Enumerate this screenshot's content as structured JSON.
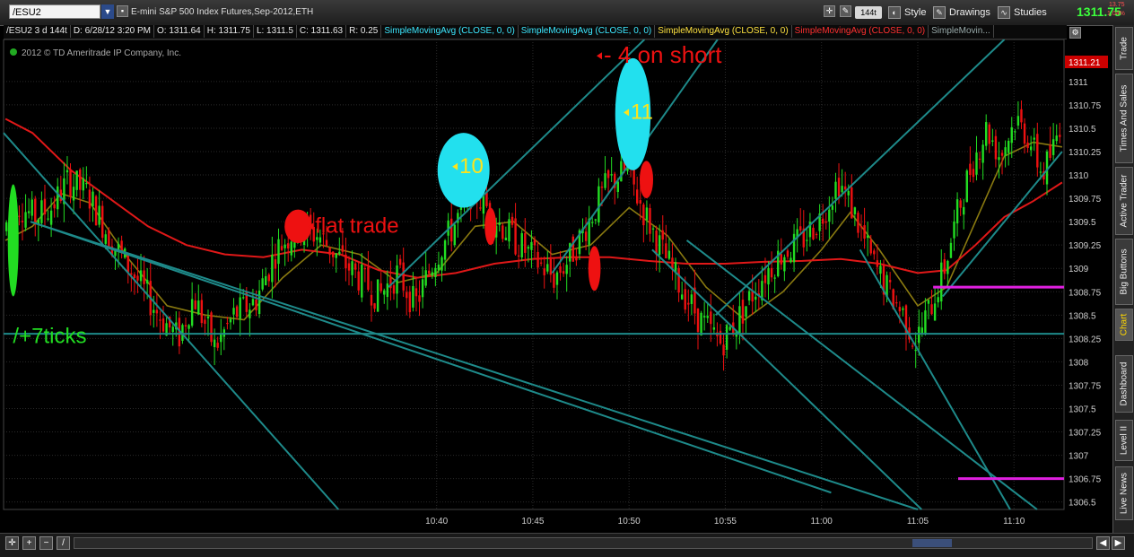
{
  "toolbar": {
    "symbol": "/ESU2",
    "title": "E-mini S&P 500 Index Futures,Sep-2012,ETH",
    "aggregation": "144t",
    "style_label": "Style",
    "drawings_label": "Drawings",
    "studies_label": "Studies",
    "last_price": "1311.75",
    "change": "13.75",
    "change_pct": "1.04%"
  },
  "infobar": {
    "symbol_period": "/ESU2 3 d 144t",
    "date": "D: 6/28/12 3:20 PM",
    "open": "O: 1311.64",
    "high": "H: 1311.75",
    "low": "L: 1311.5",
    "close": "C: 1311.63",
    "range": "R: 0.25",
    "studies": [
      {
        "label": "SimpleMovingAvg (CLOSE, 0, 0)",
        "color": "cyan"
      },
      {
        "label": "SimpleMovingAvg (CLOSE, 0, 0)",
        "color": "cyan"
      },
      {
        "label": "SimpleMovingAvg (CLOSE, 0, 0)",
        "color": "yellow"
      },
      {
        "label": "SimpleMovingAvg (CLOSE, 0, 0)",
        "color": "red"
      },
      {
        "label": "SimpleMovin...",
        "color": "gray"
      }
    ]
  },
  "copyright": "2012 © TD Ameritrade IP Company, Inc.",
  "sidebar_tabs": [
    "Trade",
    "Times And Sales",
    "Active Trader",
    "Big Buttons",
    "Chart",
    "Dashboard",
    "Level II",
    "Live News"
  ],
  "annotations": {
    "ticks": "/+7ticks",
    "flat": "flat trade",
    "short": "- 4 on short",
    "ten": "10",
    "eleven": "11"
  },
  "colors": {
    "up": "#22dd22",
    "down": "#ee1111",
    "ma_fast": "#8a7a10",
    "ma_slow": "#e01818",
    "trendline": "#1e8a8a",
    "level": "#e020e0",
    "cyan_marker": "#22e0ee",
    "red_marker": "#ee1111",
    "green_marker": "#22dd22"
  },
  "chart_data": {
    "type": "candlestick",
    "symbol": "/ESU2",
    "aggregation": "144 ticks",
    "x_ticks": [
      "10:40",
      "10:45",
      "10:50",
      "10:55",
      "11:00",
      "11:05",
      "11:10"
    ],
    "x_range_minutes": [
      617.5,
      672.6
    ],
    "y_ticks": [
      1306.5,
      1306.75,
      1307,
      1307.25,
      1307.5,
      1307.75,
      1308,
      1308.25,
      1308.5,
      1308.75,
      1309,
      1309.25,
      1309.5,
      1309.75,
      1310,
      1310.25,
      1310.5,
      1310.75,
      1311
    ],
    "ylim": [
      1306.42,
      1311.45
    ],
    "last_price_marker": "1311.21",
    "path": [
      [
        617.6,
        1309.4
      ],
      [
        618.3,
        1309.7
      ],
      [
        619.2,
        1309.55
      ],
      [
        620.1,
        1309.65
      ],
      [
        621.0,
        1309.95
      ],
      [
        622.0,
        1309.8
      ],
      [
        623.2,
        1309.3
      ],
      [
        624.5,
        1308.9
      ],
      [
        625.7,
        1308.5
      ],
      [
        626.7,
        1308.25
      ],
      [
        627.5,
        1308.7
      ],
      [
        628.6,
        1308.15
      ],
      [
        629.6,
        1308.5
      ],
      [
        630.7,
        1308.65
      ],
      [
        631.8,
        1309.2
      ],
      [
        632.9,
        1309.45
      ],
      [
        634.0,
        1309.35
      ],
      [
        635.1,
        1309.1
      ],
      [
        636.1,
        1308.9
      ],
      [
        637.1,
        1308.7
      ],
      [
        638.1,
        1308.95
      ],
      [
        639.0,
        1308.6
      ],
      [
        640.0,
        1309.1
      ],
      [
        641.0,
        1309.45
      ],
      [
        642.0,
        1309.85
      ],
      [
        643.1,
        1309.55
      ],
      [
        644.2,
        1309.3
      ],
      [
        645.2,
        1309.1
      ],
      [
        646.2,
        1308.9
      ],
      [
        647.0,
        1309.1
      ],
      [
        648.0,
        1309.5
      ],
      [
        649.0,
        1309.9
      ],
      [
        650.0,
        1310.05
      ],
      [
        650.9,
        1309.6
      ],
      [
        651.8,
        1309.2
      ],
      [
        652.8,
        1308.8
      ],
      [
        653.8,
        1308.45
      ],
      [
        654.9,
        1308.2
      ],
      [
        655.9,
        1308.5
      ],
      [
        657.0,
        1308.9
      ],
      [
        658.0,
        1309.15
      ],
      [
        659.1,
        1309.3
      ],
      [
        660.1,
        1309.55
      ],
      [
        661.0,
        1309.95
      ],
      [
        661.8,
        1309.6
      ],
      [
        662.7,
        1309.1
      ],
      [
        663.6,
        1308.75
      ],
      [
        664.4,
        1308.5
      ],
      [
        665.0,
        1308.2
      ],
      [
        665.8,
        1308.6
      ],
      [
        666.5,
        1309.0
      ],
      [
        667.2,
        1309.6
      ],
      [
        667.9,
        1310.1
      ],
      [
        668.7,
        1310.5
      ],
      [
        669.4,
        1310.2
      ],
      [
        670.2,
        1310.6
      ],
      [
        670.9,
        1310.4
      ],
      [
        671.6,
        1310.0
      ],
      [
        672.2,
        1310.3
      ],
      [
        672.5,
        1310.55
      ]
    ],
    "moving_averages": [
      {
        "color": "ma_fast",
        "points": [
          [
            617.6,
            1309.3
          ],
          [
            619.0,
            1309.45
          ],
          [
            620.5,
            1309.8
          ],
          [
            622.0,
            1309.7
          ],
          [
            624.0,
            1309.1
          ],
          [
            626.0,
            1308.6
          ],
          [
            628.0,
            1308.5
          ],
          [
            630.0,
            1308.45
          ],
          [
            632.0,
            1308.9
          ],
          [
            634.0,
            1309.25
          ],
          [
            636.0,
            1309.15
          ],
          [
            638.0,
            1308.85
          ],
          [
            640.0,
            1308.95
          ],
          [
            642.0,
            1309.45
          ],
          [
            644.0,
            1309.5
          ],
          [
            646.0,
            1309.15
          ],
          [
            648.0,
            1309.25
          ],
          [
            650.0,
            1309.65
          ],
          [
            652.0,
            1309.35
          ],
          [
            654.0,
            1308.8
          ],
          [
            656.0,
            1308.45
          ],
          [
            658.0,
            1308.75
          ],
          [
            660.0,
            1309.2
          ],
          [
            661.5,
            1309.6
          ],
          [
            663.0,
            1309.2
          ],
          [
            665.0,
            1308.6
          ],
          [
            666.5,
            1308.8
          ],
          [
            668.0,
            1309.5
          ],
          [
            669.5,
            1310.2
          ],
          [
            671.0,
            1310.35
          ],
          [
            672.5,
            1310.3
          ]
        ]
      },
      {
        "color": "ma_slow",
        "points": [
          [
            617.6,
            1310.6
          ],
          [
            619.0,
            1310.45
          ],
          [
            621.0,
            1310.05
          ],
          [
            623.0,
            1309.75
          ],
          [
            625.0,
            1309.45
          ],
          [
            627.0,
            1309.25
          ],
          [
            629.0,
            1309.15
          ],
          [
            631.0,
            1309.12
          ],
          [
            633.0,
            1309.2
          ],
          [
            635.0,
            1309.15
          ],
          [
            637.0,
            1308.98
          ],
          [
            639.0,
            1308.9
          ],
          [
            641.0,
            1308.95
          ],
          [
            643.0,
            1309.05
          ],
          [
            645.0,
            1309.1
          ],
          [
            647.0,
            1309.12
          ],
          [
            649.0,
            1309.12
          ],
          [
            651.0,
            1309.08
          ],
          [
            653.0,
            1309.05
          ],
          [
            655.0,
            1309.05
          ],
          [
            657.0,
            1309.07
          ],
          [
            659.0,
            1309.08
          ],
          [
            661.0,
            1309.1
          ],
          [
            663.0,
            1309.05
          ],
          [
            665.0,
            1308.95
          ],
          [
            666.5,
            1308.98
          ],
          [
            668.0,
            1309.25
          ],
          [
            669.5,
            1309.55
          ],
          [
            671.0,
            1309.72
          ],
          [
            672.5,
            1309.92
          ]
        ]
      }
    ],
    "trend_lines": [
      [
        617.5,
        1310.45,
        634.9,
        1306.42
      ],
      [
        618.9,
        1309.5,
        660.5,
        1306.6
      ],
      [
        618.9,
        1309.5,
        665.0,
        1306.42
      ],
      [
        637.5,
        1308.8,
        650.8,
        1311.45
      ],
      [
        646.0,
        1308.95,
        654.6,
        1311.45
      ],
      [
        651.2,
        1309.2,
        665.2,
        1306.42
      ],
      [
        653.0,
        1309.3,
        671.2,
        1306.42
      ],
      [
        654.5,
        1308.5,
        669.5,
        1311.45
      ],
      [
        666.3,
        1308.7,
        672.5,
        1310.25
      ],
      [
        662.0,
        1309.2,
        669.8,
        1306.42
      ]
    ],
    "horizontal_lines": [
      {
        "y": 1308.3,
        "x1": 617.5,
        "x2": 672.6,
        "color": "trendline"
      },
      {
        "y": 1308.8,
        "x1": 665.8,
        "x2": 672.6,
        "color": "level"
      },
      {
        "y": 1306.75,
        "x1": 667.1,
        "x2": 672.6,
        "color": "level"
      }
    ],
    "markers": [
      {
        "kind": "green_marker",
        "x": 618.0,
        "y": 1309.3,
        "rx_min": 0.28,
        "ry_price": 0.6
      },
      {
        "kind": "red_marker",
        "x": 632.8,
        "y": 1309.45,
        "rx_min": 0.7,
        "ry_price": 0.18
      },
      {
        "kind": "red_marker",
        "x": 642.8,
        "y": 1309.45,
        "rx_min": 0.3,
        "ry_price": 0.2
      },
      {
        "kind": "red_marker",
        "x": 648.2,
        "y": 1309.0,
        "rx_min": 0.32,
        "ry_price": 0.24
      },
      {
        "kind": "red_marker",
        "x": 650.9,
        "y": 1309.95,
        "rx_min": 0.35,
        "ry_price": 0.2
      },
      {
        "kind": "cyan_marker",
        "x": 641.4,
        "y": 1310.05,
        "rx_min": 1.35,
        "ry_price": 0.4
      },
      {
        "kind": "cyan_marker",
        "x": 650.2,
        "y": 1310.65,
        "rx_min": 0.92,
        "ry_price": 0.6
      }
    ],
    "labels": [
      {
        "key": "ticks",
        "x": 617.8,
        "y": 1308.2,
        "color": "green_marker",
        "size": 24
      },
      {
        "key": "flat",
        "x": 633.5,
        "y": 1309.38,
        "color": "red_marker",
        "size": 24
      },
      {
        "key": "short",
        "x": 648.5,
        "y": 1311.2,
        "color": "red_marker",
        "size": 26
      },
      {
        "key": "ten",
        "x": 641.0,
        "y": 1310.02,
        "color": "yellow",
        "size": 24
      },
      {
        "key": "eleven",
        "x": 649.9,
        "y": 1310.6,
        "color": "yellow",
        "size": 24
      }
    ]
  }
}
